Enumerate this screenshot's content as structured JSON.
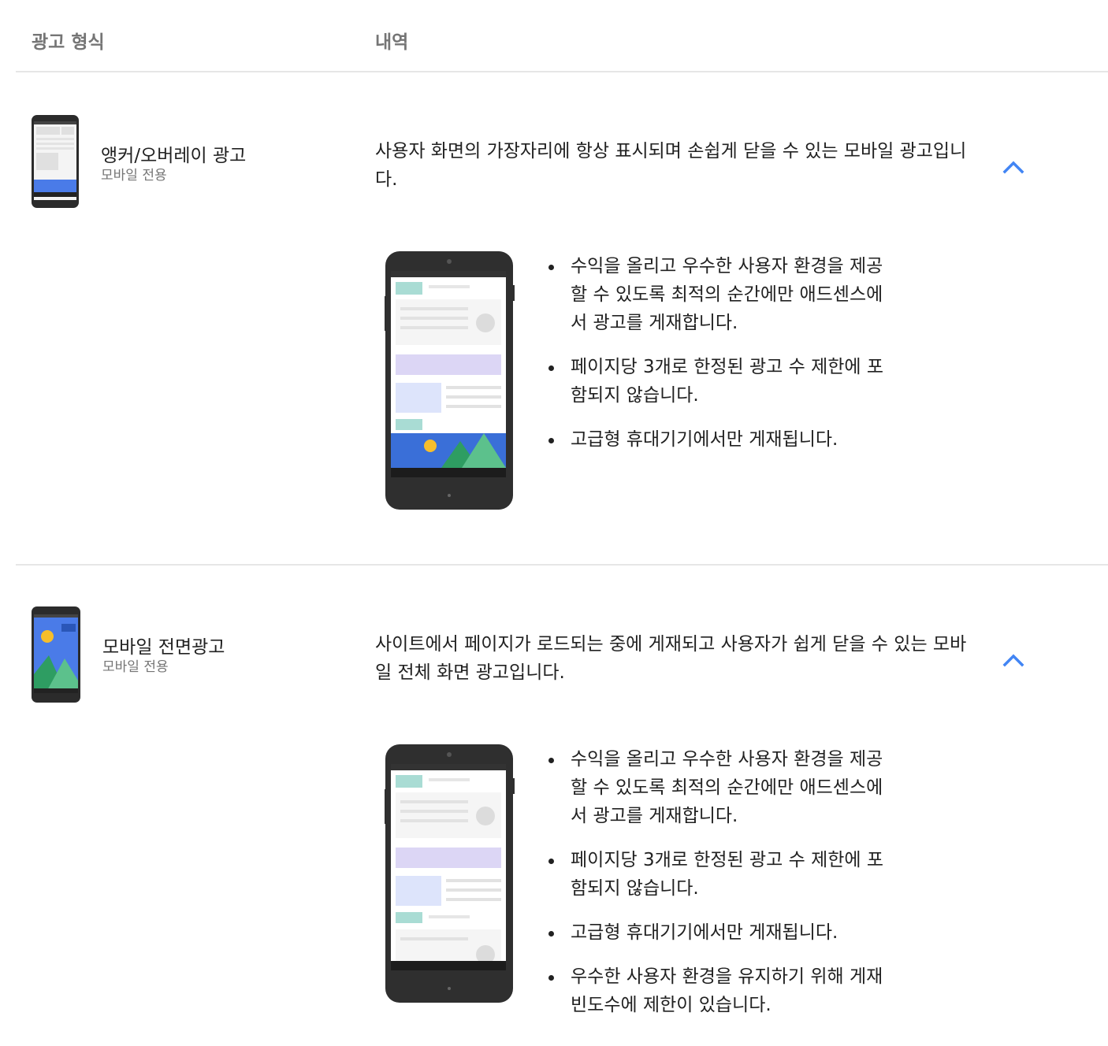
{
  "header": {
    "col_format": "광고 형식",
    "col_details": "내역"
  },
  "colors": {
    "accent": "#4285f4",
    "divider": "#e6e6e6"
  },
  "formats": [
    {
      "name": "앵커/오버레이 광고",
      "sub": "모바일 전용",
      "description": "사용자 화면의 가장자리에 항상 표시되며 손쉽게 닫을 수 있는 모바일 광고입니다.",
      "toggle_icon": "chevron-up-icon",
      "bullets": [
        "수익을 올리고 우수한 사용자 환경을 제공할 수 있도록 최적의 순간에만 애드센스에서 광고를 게재합니다.",
        "페이지당 3개로 한정된 광고 수 제한에 포함되지 않습니다.",
        "고급형 휴대기기에서만 게재됩니다."
      ]
    },
    {
      "name": "모바일 전면광고",
      "sub": "모바일 전용",
      "description": "사이트에서 페이지가 로드되는 중에 게재되고 사용자가 쉽게 닫을 수 있는 모바일 전체 화면 광고입니다.",
      "toggle_icon": "chevron-up-icon",
      "bullets": [
        "수익을 올리고 우수한 사용자 환경을 제공할 수 있도록 최적의 순간에만 애드센스에서 광고를 게재합니다.",
        "페이지당 3개로 한정된 광고 수 제한에 포함되지 않습니다.",
        "고급형 휴대기기에서만 게재됩니다.",
        "우수한 사용자 환경을 유지하기 위해 게재 빈도수에 제한이 있습니다."
      ]
    }
  ]
}
